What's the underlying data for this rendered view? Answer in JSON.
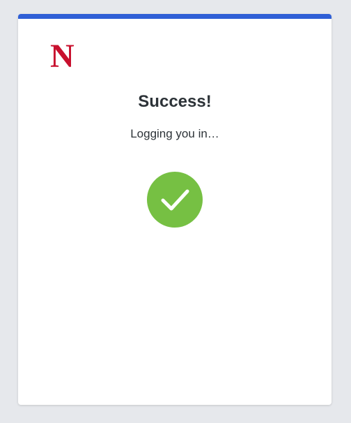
{
  "brand": {
    "logo_letter": "N",
    "logo_color": "#c8102e",
    "accent_color": "#2f5fd6"
  },
  "status": {
    "title": "Success!",
    "message": "Logging you in…",
    "icon": "checkmark-circle-icon",
    "icon_color": "#76c043"
  }
}
